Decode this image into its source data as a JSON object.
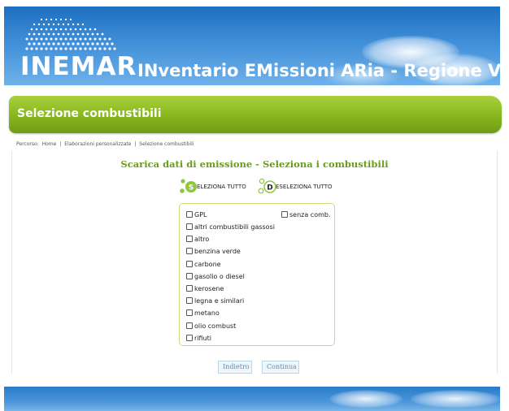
{
  "header": {
    "logo_text": "INEMAR",
    "site_title": "INventario EMissioni ARia - Regione Veneto"
  },
  "page": {
    "title": "Selezione combustibili"
  },
  "breadcrumb": {
    "prefix": "Percorso:",
    "items": [
      "Home",
      "Elaborazioni personalizzate",
      "Selezione combustibili"
    ],
    "separator": "|"
  },
  "content": {
    "heading": "Scarica dati di emissione - Seleziona i combustibili",
    "select_all": {
      "letter": "S",
      "label": "ELEZIONA TUTTO"
    },
    "deselect_all": {
      "letter": "D",
      "label": "ESELEZIONA TUTTO"
    },
    "fuels": [
      {
        "label": "GPL",
        "checked": false
      },
      {
        "label": "senza comb.",
        "checked": false
      },
      {
        "label": "altri combustibili gassosi",
        "checked": false
      },
      {
        "label": "altro",
        "checked": false
      },
      {
        "label": "benzina verde",
        "checked": false
      },
      {
        "label": "carbone",
        "checked": false
      },
      {
        "label": "gasolio o diesel",
        "checked": false
      },
      {
        "label": "kerosene",
        "checked": false
      },
      {
        "label": "legna e similari",
        "checked": false
      },
      {
        "label": "metano",
        "checked": false
      },
      {
        "label": "olio combust",
        "checked": false
      },
      {
        "label": "rifiuti",
        "checked": false
      }
    ],
    "buttons": {
      "back": "Indietro",
      "continue": "Continua"
    }
  },
  "colors": {
    "header_blue": "#1d6fbf",
    "title_green": "#8dbb22",
    "heading_green": "#6a9c1e",
    "button_text": "#5b8fb4"
  }
}
